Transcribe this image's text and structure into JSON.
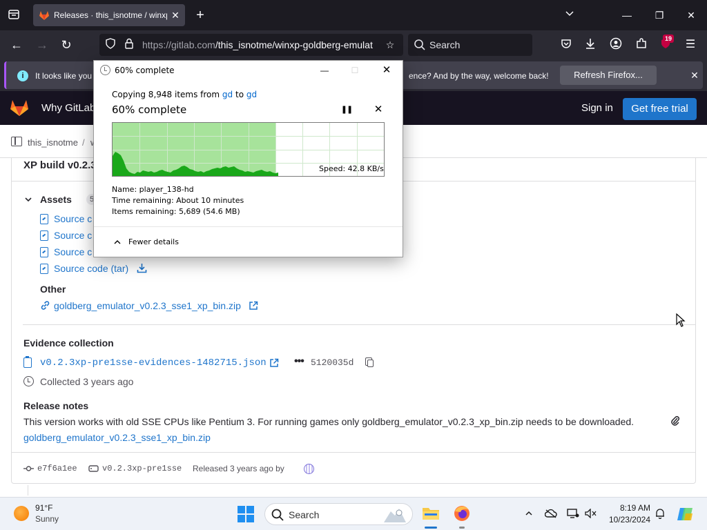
{
  "browser": {
    "tab": {
      "title": "Releases · this_isnotme / winxp"
    },
    "url": {
      "host": "https://gitlab.com",
      "path": "/this_isnotme/winxp-goldberg-emulat"
    },
    "search_placeholder": "Search",
    "extension_badge": "19"
  },
  "notification": {
    "message_left": "It looks like you h",
    "message_right": "ence? And by the way, welcome back!",
    "refresh_label": "Refresh Firefox..."
  },
  "gitlab_header": {
    "why_gitlab": "Why GitLab",
    "sign_in": "Sign in",
    "free_trial": "Get free trial"
  },
  "breadcrumb": {
    "project": "this_isnotme",
    "separator": "/",
    "next": "w"
  },
  "release": {
    "title_partial": "XP build v0.2.3",
    "assets": {
      "label": "Assets",
      "count": "5",
      "source_items": [
        "Source c",
        "Source c",
        "Source c",
        "Source code (tar)"
      ],
      "other_label": "Other",
      "other_link": "goldberg_emulator_v0.2.3_sse1_xp_bin.zip"
    },
    "evidence": {
      "label": "Evidence collection",
      "file": "v0.2.3xp-pre1sse-evidences-1482715.json",
      "sha": "5120035d",
      "collected": "Collected 3 years ago"
    },
    "notes": {
      "label": "Release notes",
      "text": "This version works with old SSE CPUs like Pentium 3. For running games only goldberg_emulator_v0.2.3_xp_bin.zip needs to be downloaded.",
      "link": "goldberg_emulator_v0.2.3_sse1_xp_bin.zip"
    },
    "footer": {
      "commit": "e7f6a1ee",
      "tag": "v0.2.3xp-pre1sse",
      "released": "Released 3 years ago by"
    }
  },
  "copy_dialog": {
    "window_title": "60% complete",
    "copying_prefix": "Copying 8,948 items from",
    "source": "gd",
    "copying_to": "to",
    "destination": "gd",
    "percent_label": "60% complete",
    "progress": 0.6,
    "speed": "Speed: 42.8 KB/s",
    "name": "Name:  player_138-hd",
    "time_remaining": "Time remaining:  About 10 minutes",
    "items_remaining": "Items remaining:  5,689 (54.6 MB)",
    "fewer_details": "Fewer details",
    "colors": {
      "progress_fill": "#a7e39b",
      "speed_fill": "#1aa81a"
    }
  },
  "taskbar": {
    "weather_temp": "91°F",
    "weather_desc": "Sunny",
    "search_placeholder": "Search",
    "time": "8:19 AM",
    "date": "10/23/2024"
  }
}
